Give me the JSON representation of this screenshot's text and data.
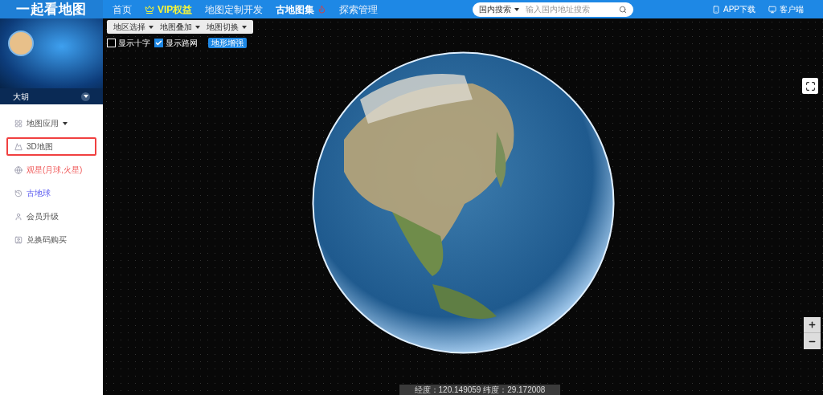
{
  "logo": {
    "title": "一起看地图"
  },
  "nav": [
    {
      "label": "首页",
      "kind": "plain"
    },
    {
      "label": "VIP权益",
      "kind": "vip"
    },
    {
      "label": "地图定制开发",
      "kind": "plain"
    },
    {
      "label": "古地图集",
      "kind": "hot"
    },
    {
      "label": "探索管理",
      "kind": "plain"
    }
  ],
  "search": {
    "scope": "国内搜索",
    "placeholder": "输入国内地址搜索"
  },
  "top_links": [
    {
      "label": "APP下载",
      "kind": "phone"
    },
    {
      "label": "客户端",
      "kind": "desktop"
    }
  ],
  "profile": {
    "name": "大胡"
  },
  "sidebar": {
    "items": [
      {
        "label": "地图应用",
        "kind": "grid",
        "selected": false
      },
      {
        "label": "3D地图",
        "kind": "mountain",
        "selected": true
      },
      {
        "label": "观星(月球,火星)",
        "kind": "globe",
        "selected": false
      },
      {
        "label": "古地球",
        "kind": "history",
        "selected": false
      },
      {
        "label": "会员升级",
        "kind": "user",
        "selected": false
      },
      {
        "label": "兑换码购买",
        "kind": "card",
        "selected": false
      }
    ]
  },
  "toolbar": {
    "dropdowns": [
      "地区选择",
      "地图叠加",
      "地图切换"
    ],
    "checkboxes": [
      {
        "label": "显示十字",
        "checked": false
      },
      {
        "label": "显示路网",
        "checked": true
      }
    ],
    "button": "地形增强"
  },
  "status_bar": {
    "text": "经度：120.149059 纬度：29.172008"
  }
}
